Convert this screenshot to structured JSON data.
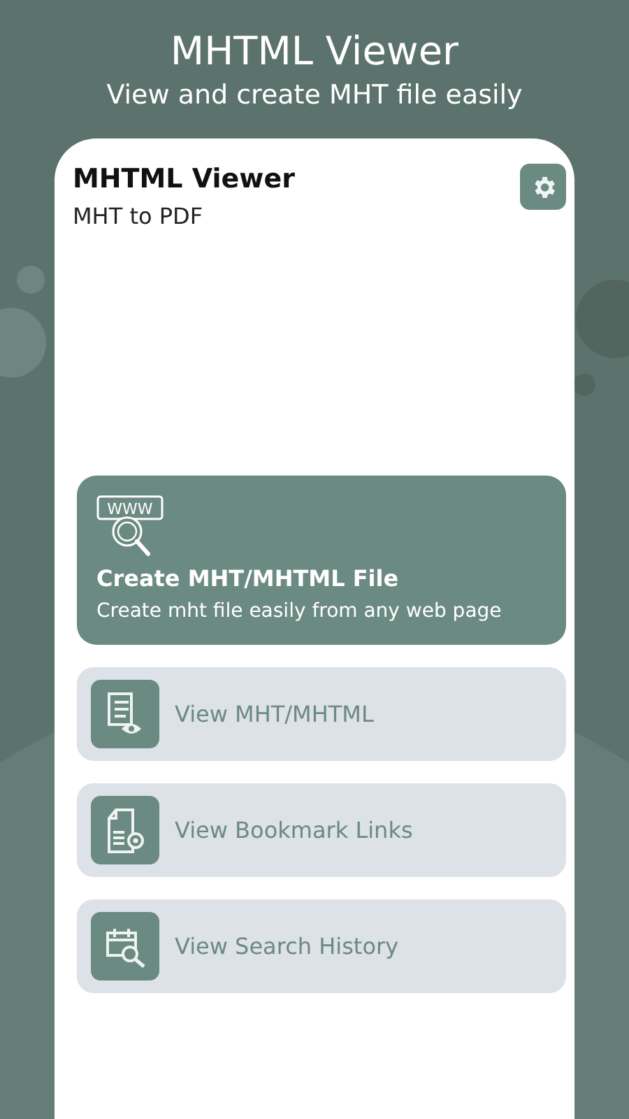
{
  "header": {
    "title": "MHTML Viewer",
    "subtitle": "View and create MHT file easily"
  },
  "app": {
    "title": "MHTML Viewer",
    "subtitle": "MHT to PDF"
  },
  "create_card": {
    "icon_text": "WWW",
    "title": "Create MHT/MHTML File",
    "description": "Create mht file easily from any web page"
  },
  "menu": [
    {
      "kind": "document-eye",
      "label": "View MHT/MHTML"
    },
    {
      "kind": "bookmark-doc",
      "label": "View Bookmark Links"
    },
    {
      "kind": "calendar-search",
      "label": "View Search History"
    }
  ]
}
